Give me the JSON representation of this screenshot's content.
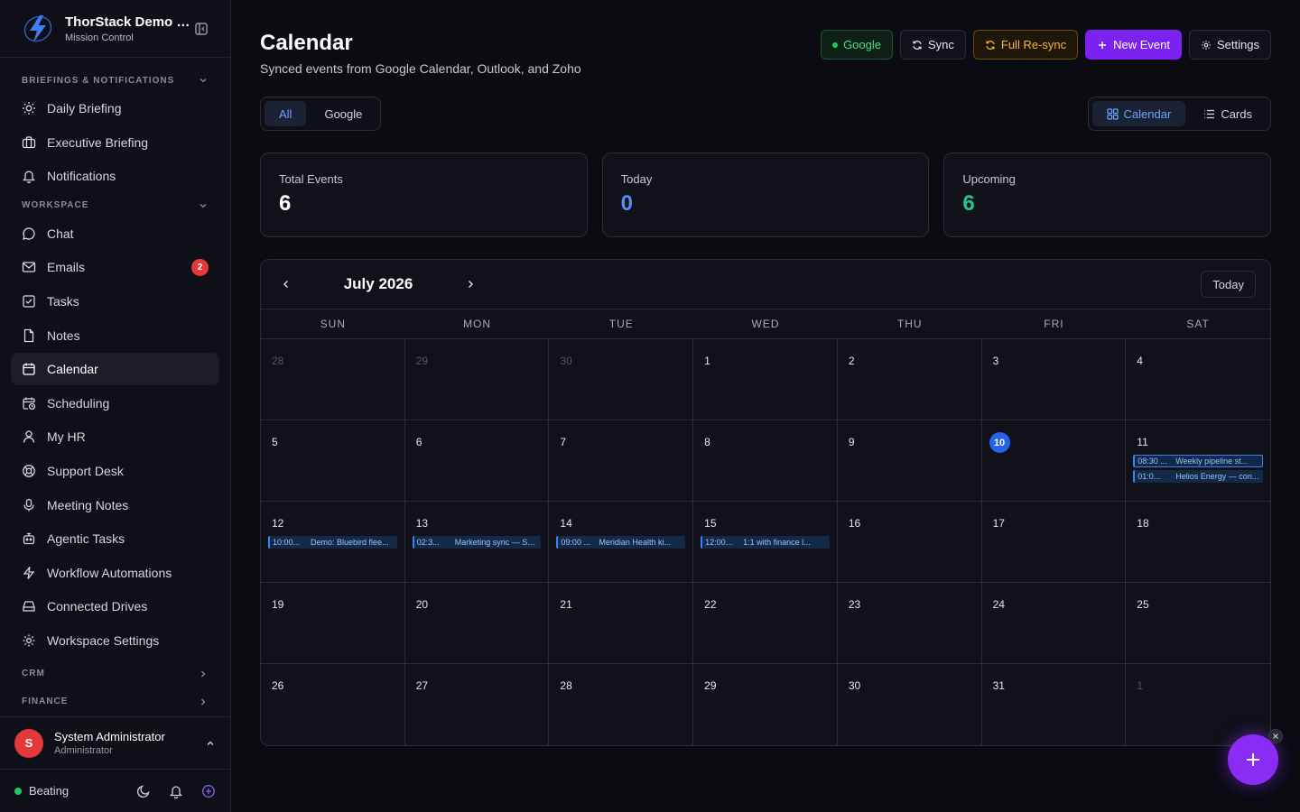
{
  "brand": {
    "title": "ThorStack Demo C...",
    "subtitle": "Mission Control"
  },
  "sections": {
    "briefings": "BRIEFINGS & NOTIFICATIONS",
    "workspace": "WORKSPACE",
    "crm": "CRM",
    "finance": "FINANCE"
  },
  "nav": {
    "daily_briefing": "Daily Briefing",
    "executive_briefing": "Executive Briefing",
    "notifications": "Notifications",
    "chat": "Chat",
    "emails": "Emails",
    "emails_badge": "2",
    "tasks": "Tasks",
    "notes": "Notes",
    "calendar": "Calendar",
    "scheduling": "Scheduling",
    "my_hr": "My HR",
    "support_desk": "Support Desk",
    "meeting_notes": "Meeting Notes",
    "agentic_tasks": "Agentic Tasks",
    "workflow_automations": "Workflow Automations",
    "connected_drives": "Connected Drives",
    "workspace_settings": "Workspace Settings"
  },
  "user": {
    "initial": "S",
    "name": "System Administrator",
    "role": "Administrator"
  },
  "footer": {
    "status": "Beating"
  },
  "header": {
    "title": "Calendar",
    "subtitle": "Synced events from Google Calendar, Outlook, and Zoho"
  },
  "actions": {
    "google": "Google",
    "sync": "Sync",
    "full_resync": "Full Re-sync",
    "new_event": "New Event",
    "settings": "Settings"
  },
  "filters": {
    "all": "All",
    "google": "Google"
  },
  "views": {
    "calendar": "Calendar",
    "cards": "Cards"
  },
  "stats": {
    "total": {
      "label": "Total Events",
      "value": "6",
      "color": "#ffffff"
    },
    "today": {
      "label": "Today",
      "value": "0",
      "color": "#4f8ff7"
    },
    "upcoming": {
      "label": "Upcoming",
      "value": "6",
      "color": "#22c58b"
    }
  },
  "calendar": {
    "month": "July 2026",
    "today_button": "Today",
    "weekdays": [
      "SUN",
      "MON",
      "TUE",
      "WED",
      "THU",
      "FRI",
      "SAT"
    ],
    "days": [
      {
        "d": "28",
        "muted": true
      },
      {
        "d": "29",
        "muted": true
      },
      {
        "d": "30",
        "muted": true
      },
      {
        "d": "1"
      },
      {
        "d": "2"
      },
      {
        "d": "3"
      },
      {
        "d": "4"
      },
      {
        "d": "5"
      },
      {
        "d": "6"
      },
      {
        "d": "7"
      },
      {
        "d": "8"
      },
      {
        "d": "9"
      },
      {
        "d": "10",
        "today": true
      },
      {
        "d": "11",
        "events": [
          {
            "time": "08:30 ...",
            "name": "Weekly pipeline st...",
            "outlined": true
          },
          {
            "time": "01:0...",
            "name": "Helios Energy — con..."
          }
        ]
      },
      {
        "d": "12",
        "events": [
          {
            "time": "10:00...",
            "name": "Demo: Bluebird flee..."
          }
        ]
      },
      {
        "d": "13",
        "events": [
          {
            "time": "02:3...",
            "name": "Marketing sync — Se..."
          }
        ]
      },
      {
        "d": "14",
        "events": [
          {
            "time": "09:00 ...",
            "name": "Meridian Health ki..."
          }
        ]
      },
      {
        "d": "15",
        "events": [
          {
            "time": "12:00 p....",
            "name": "1:1 with finance l..."
          }
        ]
      },
      {
        "d": "16"
      },
      {
        "d": "17"
      },
      {
        "d": "18"
      },
      {
        "d": "19"
      },
      {
        "d": "20"
      },
      {
        "d": "21"
      },
      {
        "d": "22"
      },
      {
        "d": "23"
      },
      {
        "d": "24"
      },
      {
        "d": "25"
      },
      {
        "d": "26"
      },
      {
        "d": "27"
      },
      {
        "d": "28"
      },
      {
        "d": "29"
      },
      {
        "d": "30"
      },
      {
        "d": "31"
      },
      {
        "d": "1",
        "muted": true
      }
    ]
  }
}
